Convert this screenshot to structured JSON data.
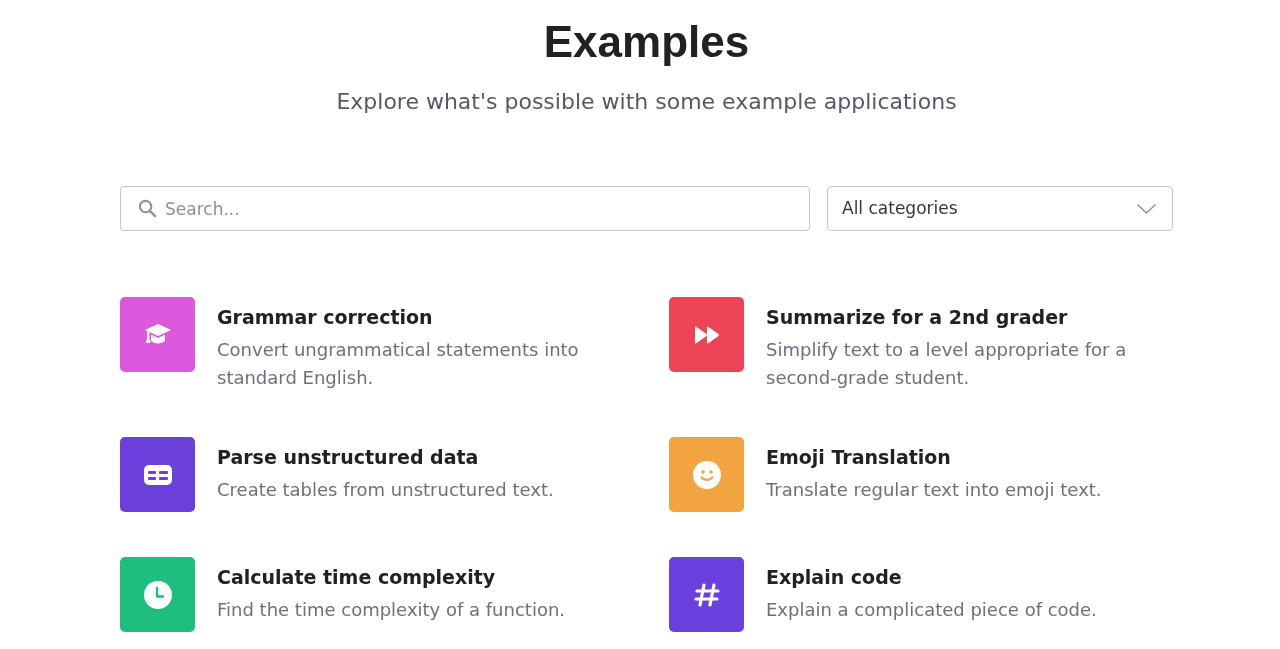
{
  "header": {
    "title": "Examples",
    "subtitle": "Explore what's possible with some example applications"
  },
  "search": {
    "placeholder": "Search..."
  },
  "category_filter": {
    "value": "All categories"
  },
  "examples": [
    {
      "title": "Grammar correction",
      "description": "Convert ungrammatical statements into standard English.",
      "color": "#dc58dc"
    },
    {
      "title": "Summarize for a 2nd grader",
      "description": "Simplify text to a level appropriate for a second-grade student.",
      "color": "#ec4356"
    },
    {
      "title": "Parse unstructured data",
      "description": "Create tables from unstructured text.",
      "color": "#6a3fdc"
    },
    {
      "title": "Emoji Translation",
      "description": "Translate regular text into emoji text.",
      "color": "#f1a43f"
    },
    {
      "title": "Calculate time complexity",
      "description": "Find the time complexity of a function.",
      "color": "#1dbe80"
    },
    {
      "title": "Explain code",
      "description": "Explain a complicated piece of code.",
      "color": "#6a40de"
    }
  ]
}
